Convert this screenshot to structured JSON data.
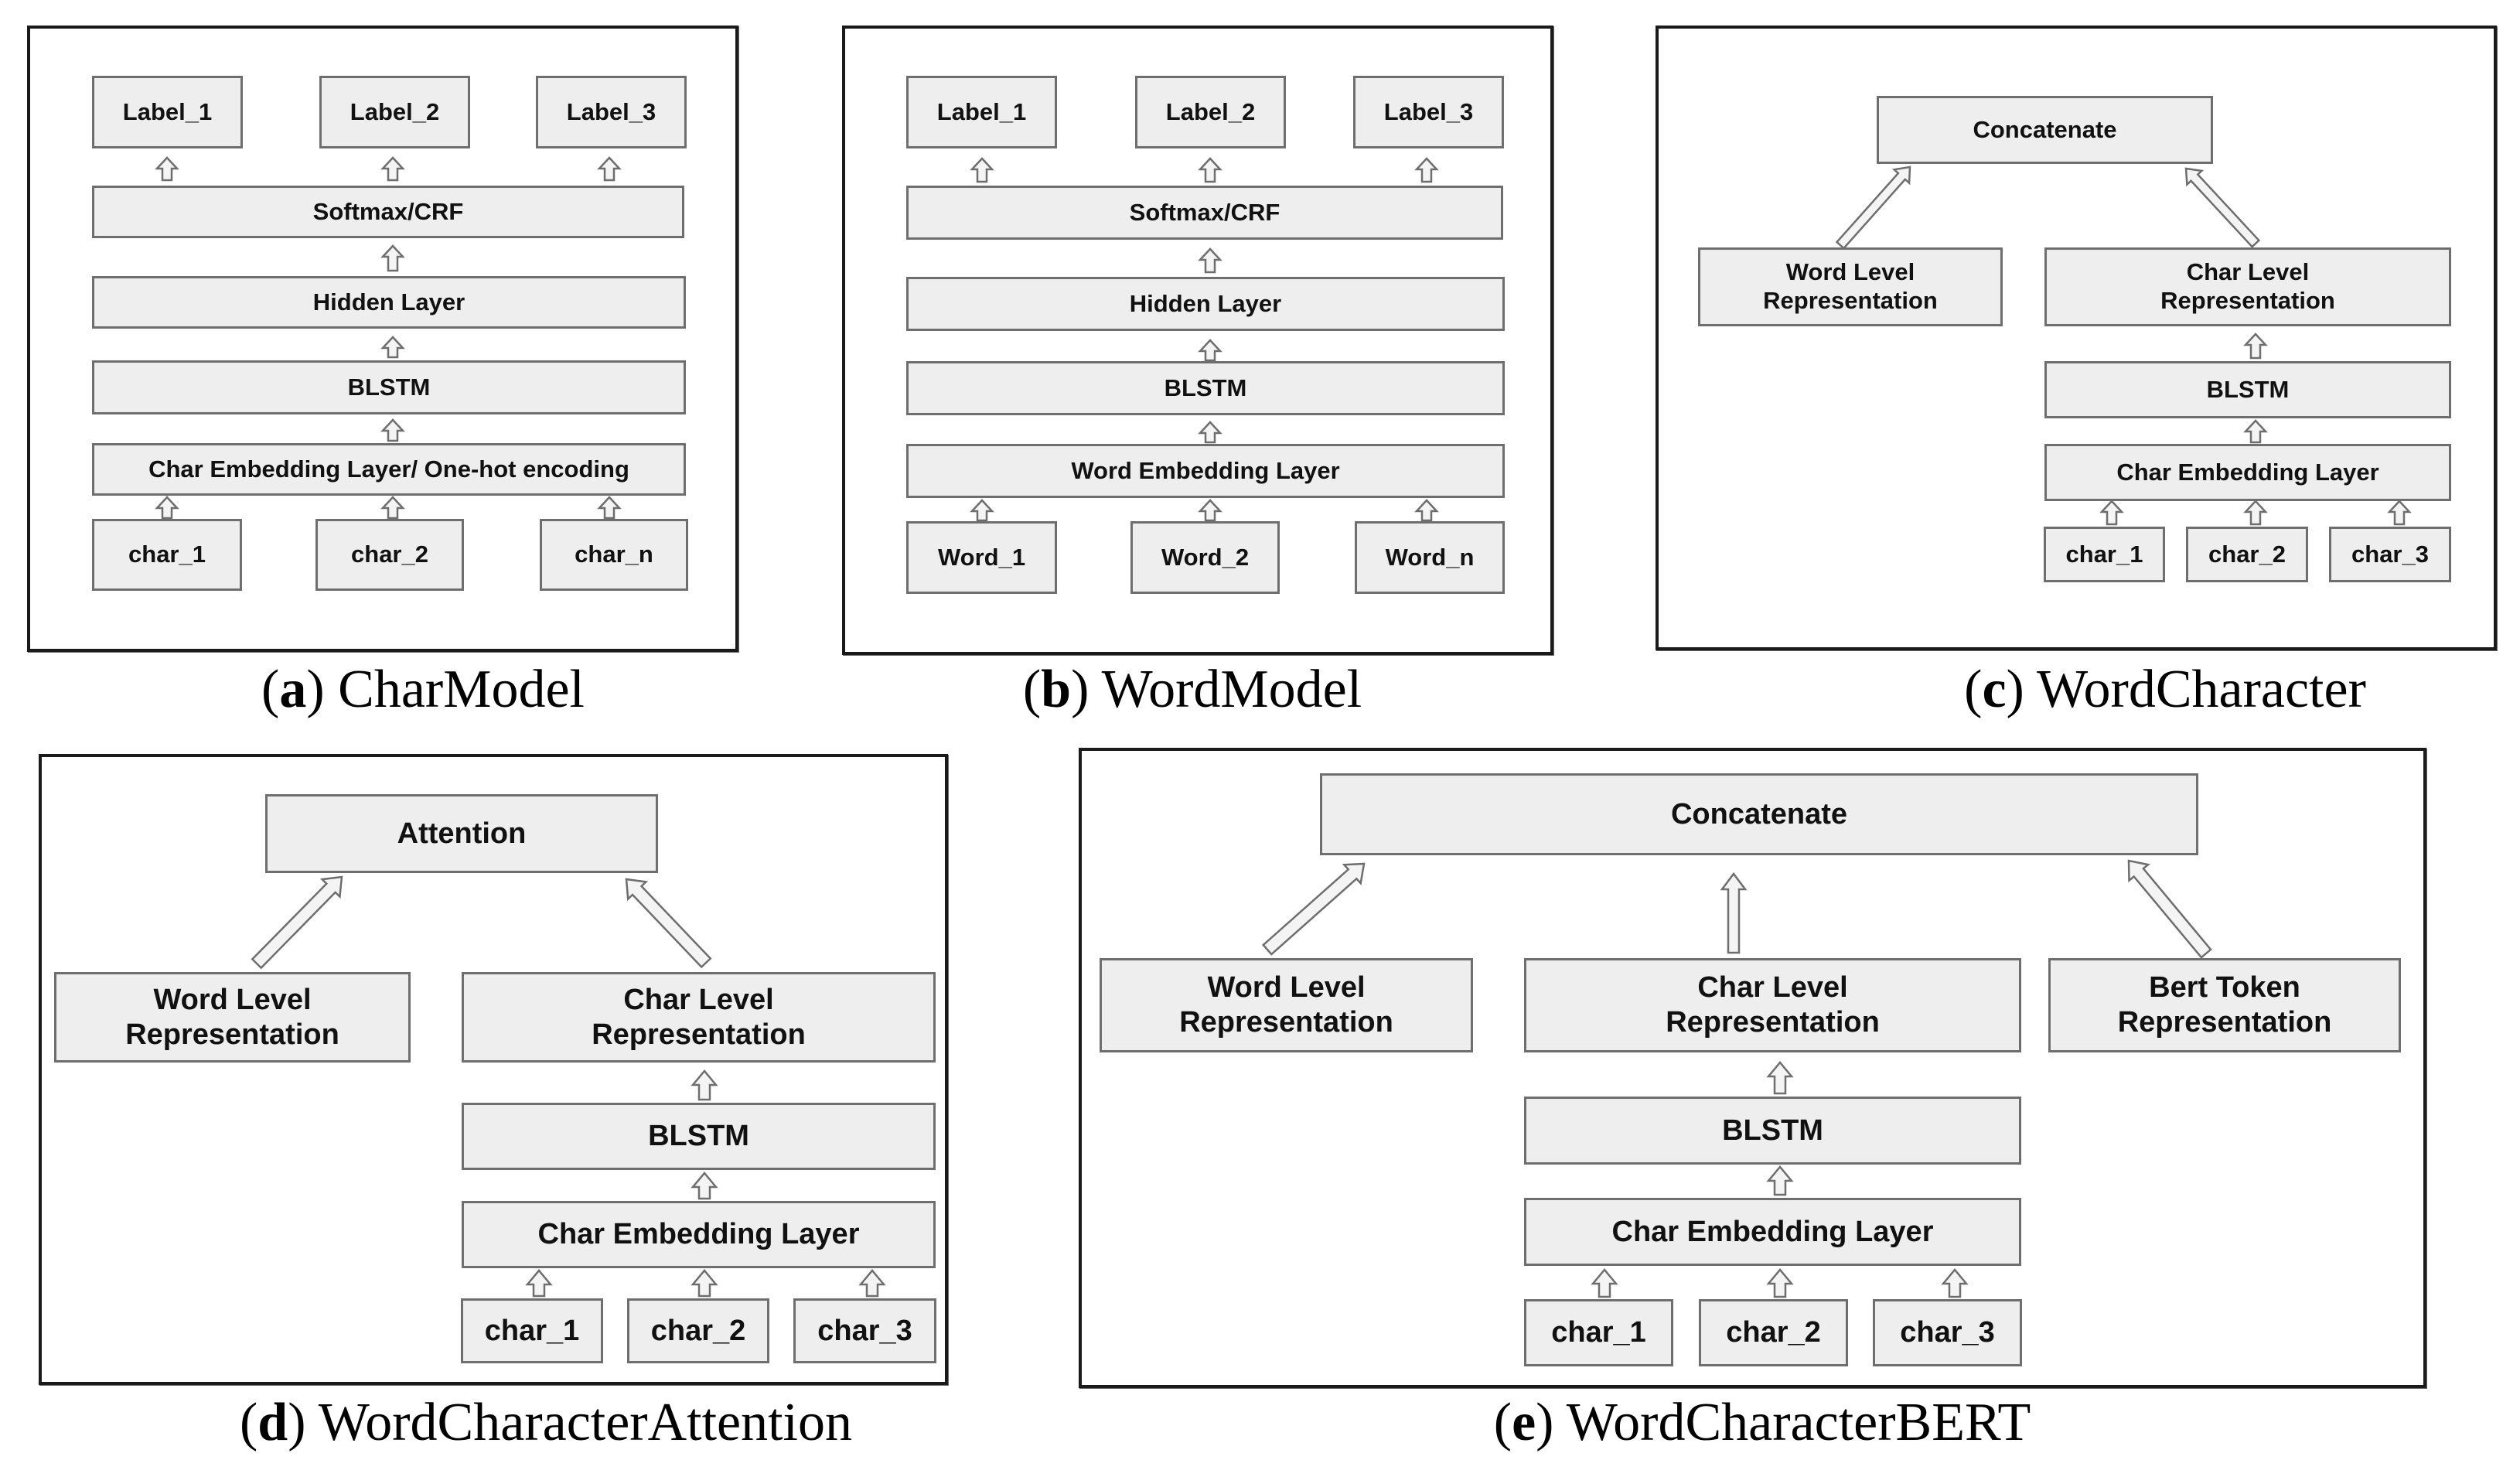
{
  "figure": {
    "panels": [
      {
        "id": "a",
        "caption_letter": "a",
        "caption_title": "CharModel",
        "labels": [
          "Label_1",
          "Label_2",
          "Label_3"
        ],
        "softmax": "Softmax/CRF",
        "hidden": "Hidden Layer",
        "blstm": "BLSTM",
        "embedding": "Char Embedding Layer/ One-hot encoding",
        "inputs": [
          "char_1",
          "char_2",
          "char_n"
        ]
      },
      {
        "id": "b",
        "caption_letter": "b",
        "caption_title": "WordModel",
        "labels": [
          "Label_1",
          "Label_2",
          "Label_3"
        ],
        "softmax": "Softmax/CRF",
        "hidden": "Hidden Layer",
        "blstm": "BLSTM",
        "embedding": "Word Embedding Layer",
        "inputs": [
          "Word_1",
          "Word_2",
          "Word_n"
        ]
      },
      {
        "id": "c",
        "caption_letter": "c",
        "caption_title": "WordCharacter",
        "top": "Concatenate",
        "word_rep": [
          "Word Level",
          "Representation"
        ],
        "char_rep": [
          "Char Level",
          "Representation"
        ],
        "blstm": "BLSTM",
        "embedding": "Char Embedding Layer",
        "inputs": [
          "char_1",
          "char_2",
          "char_3"
        ]
      },
      {
        "id": "d",
        "caption_letter": "d",
        "caption_title": "WordCharacterAttention",
        "top": "Attention",
        "word_rep": [
          "Word Level",
          "Representation"
        ],
        "char_rep": [
          "Char Level",
          "Representation"
        ],
        "blstm": "BLSTM",
        "embedding": "Char Embedding Layer",
        "inputs": [
          "char_1",
          "char_2",
          "char_3"
        ]
      },
      {
        "id": "e",
        "caption_letter": "e",
        "caption_title": "WordCharacterBERT",
        "top": "Concatenate",
        "word_rep": [
          "Word Level",
          "Representation"
        ],
        "char_rep": [
          "Char Level",
          "Representation"
        ],
        "bert_rep": [
          "Bert Token",
          "Representation"
        ],
        "blstm": "BLSTM",
        "embedding": "Char Embedding Layer",
        "inputs": [
          "char_1",
          "char_2",
          "char_3"
        ]
      }
    ]
  },
  "colors": {
    "box_fill": "#eeeeee",
    "box_border": "#6e6e6e",
    "frame": "#1a1a1a",
    "arrow_fill": "#f4f4f4",
    "arrow_stroke": "#6e6e6e"
  }
}
